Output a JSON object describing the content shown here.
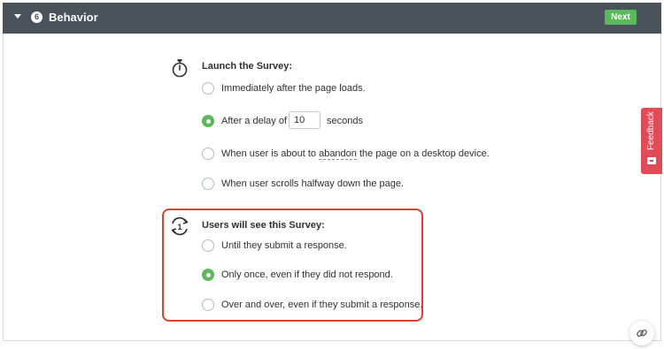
{
  "header": {
    "step_number": "6",
    "title": "Behavior",
    "next_label": "Next"
  },
  "launch": {
    "title": "Launch the Survey:",
    "options": [
      {
        "label": "Immediately after the page loads.",
        "selected": false
      },
      {
        "label_before": "After a delay of",
        "delay_value": "10",
        "label_after": "seconds",
        "selected": true
      },
      {
        "label_before": "When user is about to",
        "label_link": "abandon",
        "label_after": "the page on a desktop device.",
        "selected": false
      },
      {
        "label": "When user scrolls halfway down the page.",
        "selected": false
      }
    ]
  },
  "frequency": {
    "title": "Users will see this Survey:",
    "icon_number": "1",
    "options": [
      {
        "label": "Until they submit a response.",
        "selected": false
      },
      {
        "label": "Only once, even if they did not respond.",
        "selected": true
      },
      {
        "label": "Over and over, even if they submit a response.",
        "selected": false
      }
    ]
  },
  "feedback_tab": {
    "label": "Feedback"
  },
  "colors": {
    "header_bg": "#4a525b",
    "accent_green": "#5cb85c",
    "highlight_red": "#e0402e",
    "feedback_red": "#e14a57"
  },
  "icons": [
    "caret-down-icon",
    "stopwatch-icon",
    "repeat-once-icon",
    "feedback-smile-icon",
    "link-icon"
  ]
}
